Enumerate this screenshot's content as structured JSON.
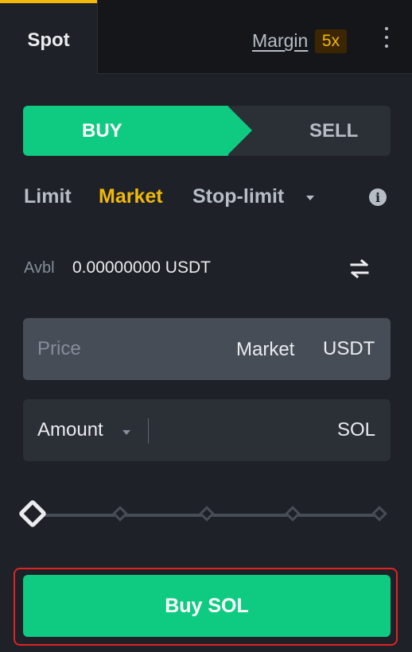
{
  "tabs": {
    "spot_label": "Spot",
    "margin_label": "Margin",
    "leverage_badge": "5x"
  },
  "side_toggle": {
    "buy_label": "BUY",
    "sell_label": "SELL"
  },
  "order_types": {
    "limit": "Limit",
    "market": "Market",
    "stop_limit": "Stop-limit",
    "selected": "Market"
  },
  "available": {
    "label": "Avbl",
    "value": "0.00000000 USDT"
  },
  "price_field": {
    "placeholder": "Price",
    "value": "Market",
    "unit": "USDT"
  },
  "amount_field": {
    "label": "Amount",
    "value": "",
    "unit": "SOL"
  },
  "slider": {
    "value_percent": 0,
    "stops_percent": [
      0,
      25,
      50,
      75,
      100
    ]
  },
  "submit": {
    "label": "Buy SOL"
  },
  "colors": {
    "accent": "#f0b90b",
    "buy": "#0ecb81",
    "highlight_outline": "#e02424",
    "background": "#1e2127"
  },
  "icons": [
    "kebab-menu-icon",
    "info-icon",
    "swap-icon",
    "caret-down-icon"
  ]
}
